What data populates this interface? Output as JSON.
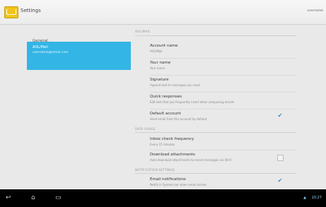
{
  "app": {
    "title": "Settings",
    "account_tag": "username"
  },
  "headers": [
    {
      "label": "General"
    },
    {
      "label": "AOL/Mail",
      "sub": "username@email.com"
    }
  ],
  "content": {
    "top_category": "AOL/MAIL",
    "prefs_account": [
      {
        "title": "Account name",
        "summary": "AOL/Mail"
      },
      {
        "title": "Your name",
        "summary": "Your name"
      },
      {
        "title": "Signature",
        "summary": "Append text to messages you send"
      },
      {
        "title": "Quick responses",
        "summary": "Edit text that you frequently insert when composing emails"
      },
      {
        "title": "Default account",
        "summary": "Send email from this account by default",
        "checked": true
      }
    ],
    "cat_data": "DATA USAGE",
    "prefs_data": [
      {
        "title": "Inbox check frequency",
        "summary": "Every 15 minutes"
      },
      {
        "title": "Download attachments",
        "summary": "Auto-download attachments to recent messages via Wi-Fi",
        "checked": false
      }
    ],
    "cat_notif": "NOTIFICATION SETTINGS",
    "prefs_notif": [
      {
        "title": "Email notifications",
        "summary": "Notify in System bar when email arrives",
        "checked": true
      }
    ]
  },
  "navbar": {
    "back": "↩",
    "home": "⌂",
    "recent": "▭",
    "time": "10:27",
    "signal": "▲"
  },
  "colors": {
    "accent": "#33b5e5",
    "check": "#2f8fc8"
  }
}
